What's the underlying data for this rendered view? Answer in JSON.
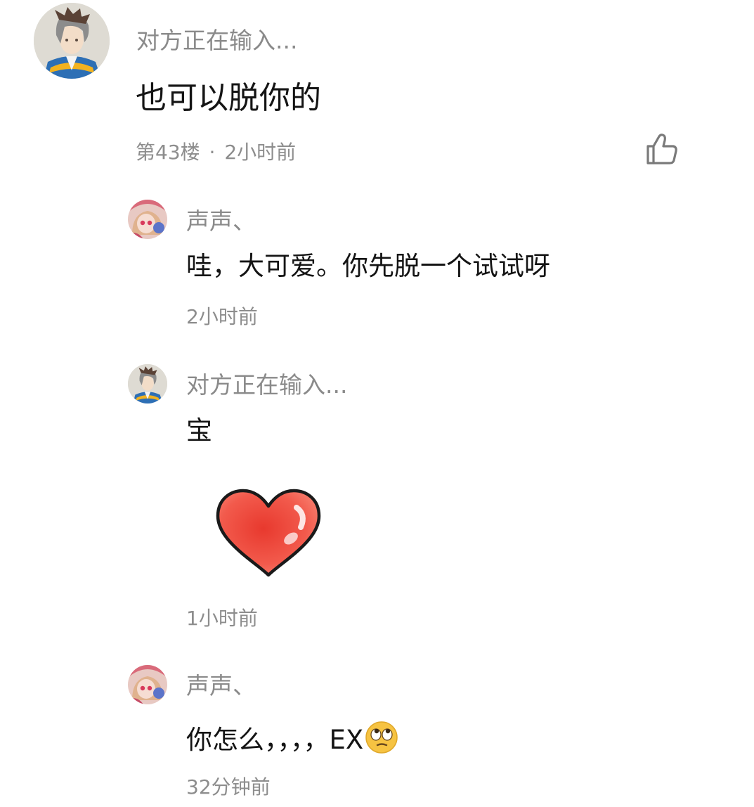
{
  "main_comment": {
    "author": "对方正在输入...",
    "text": "也可以脱你的",
    "floor": "第43楼",
    "separator": "·",
    "time": "2小时前",
    "like_icon": "thumbs-up-icon"
  },
  "replies": [
    {
      "author": "声声、",
      "text": "哇，大可爱。你先脱一个试试呀",
      "time": "2小时前"
    },
    {
      "author": "对方正在输入...",
      "text": "宝",
      "sticker": "heart-sticker",
      "time": "1小时前"
    },
    {
      "author": "声声、",
      "text": "你怎么，，，，EX",
      "emoji": "eye-roll-emoji",
      "time": "32分钟前"
    }
  ],
  "colors": {
    "text_primary": "#141414",
    "text_secondary": "#8a8a8a",
    "heart": "#e8392e"
  }
}
